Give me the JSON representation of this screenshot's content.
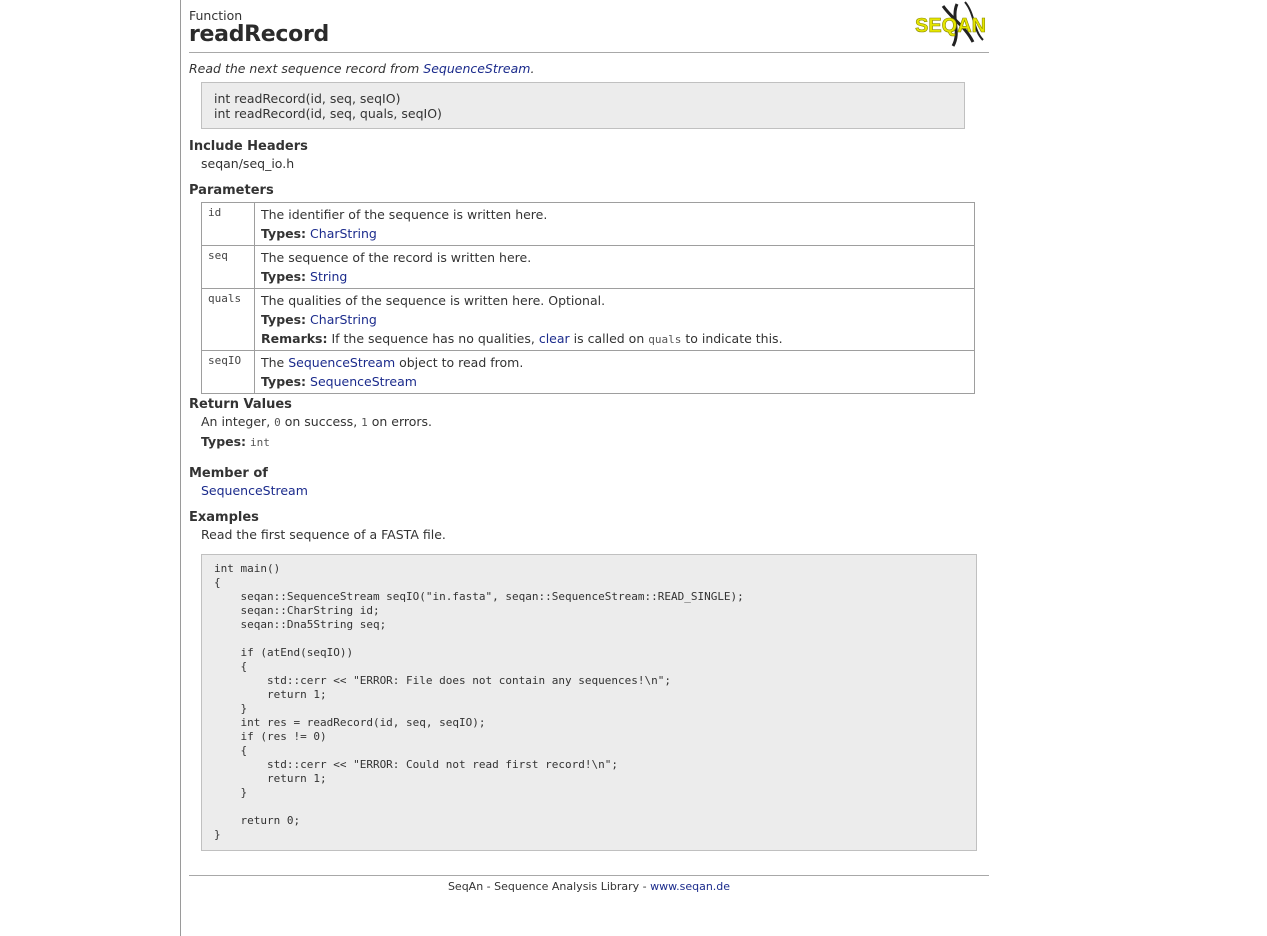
{
  "header": {
    "kind": "Function",
    "title": "readRecord",
    "logo_text": "SEQAN"
  },
  "summary": {
    "text": "Read the next sequence record from ",
    "link": "SequenceStream",
    "end": "."
  },
  "signatures": [
    "int readRecord(id, seq, seqIO)",
    "int readRecord(id, seq, quals, seqIO)"
  ],
  "include": {
    "heading": "Include Headers",
    "value": "seqan/seq_io.h"
  },
  "parameters": {
    "heading": "Parameters",
    "types_label": "Types:",
    "remarks_label": "Remarks:",
    "rows": [
      {
        "name": "id",
        "desc": "The identifier of the sequence is written here.",
        "type": "CharString"
      },
      {
        "name": "seq",
        "desc": "The sequence of the record is written here.",
        "type": "String"
      },
      {
        "name": "quals",
        "desc": "The qualities of the sequence is written here. Optional.",
        "type": "CharString",
        "remark_pre": "If the sequence has no qualities, ",
        "remark_link": "clear",
        "remark_mid": " is called on ",
        "remark_code": "quals",
        "remark_post": " to indicate this."
      },
      {
        "name": "seqIO",
        "desc_pre": "The ",
        "desc_link": "SequenceStream",
        "desc_post": " object to read from.",
        "type": "SequenceStream"
      }
    ]
  },
  "return_values": {
    "heading": "Return Values",
    "pre": "An integer, ",
    "code1": "0",
    "mid": " on success, ",
    "code2": "1",
    "post": " on errors.",
    "types_label": "Types:",
    "type": "int"
  },
  "member_of": {
    "heading": "Member of",
    "link": "SequenceStream"
  },
  "examples": {
    "heading": "Examples",
    "desc": "Read the first sequence of a FASTA file.",
    "code": "int main()\n{\n    seqan::SequenceStream seqIO(\"in.fasta\", seqan::SequenceStream::READ_SINGLE);\n    seqan::CharString id;\n    seqan::Dna5String seq;\n\n    if (atEnd(seqIO))\n    {\n        std::cerr << \"ERROR: File does not contain any sequences!\\n\";\n        return 1;\n    }\n    int res = readRecord(id, seq, seqIO);\n    if (res != 0)\n    {\n        std::cerr << \"ERROR: Could not read first record!\\n\";\n        return 1;\n    }\n\n    return 0;\n}"
  },
  "footer": {
    "text": "SeqAn - Sequence Analysis Library - ",
    "link": "www.seqan.de"
  },
  "colors": {
    "link": "#1b2b8c",
    "code_bg": "#ececec",
    "logo_yellow": "#e6e600"
  }
}
